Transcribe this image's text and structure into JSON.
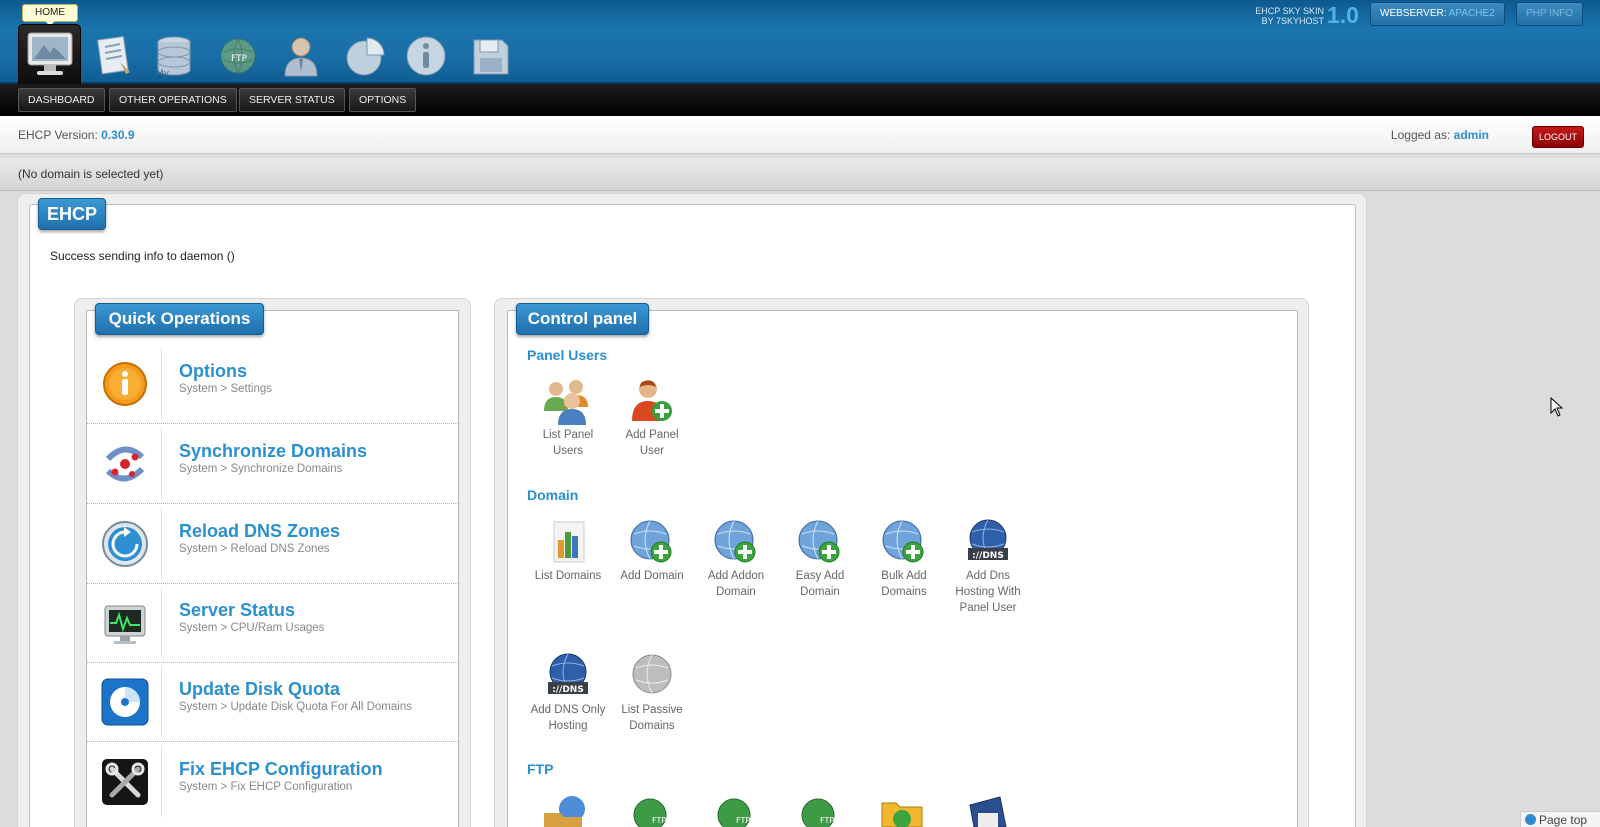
{
  "header": {
    "home_tooltip": "HOME",
    "skin_line1": "EHCP SKY SKIN",
    "skin_line2": "BY 7SKYHOST",
    "skin_version": "1.0",
    "webserver_label": "WEBSERVER:",
    "webserver_value": "APACHE2",
    "phpinfo_label": "PHP INFO",
    "nav_icons": [
      "home-monitor-icon",
      "document-icon",
      "mysql-database-icon",
      "ftp-globe-icon",
      "user-icon",
      "pie-chart-icon",
      "info-icon",
      "floppy-disk-icon"
    ]
  },
  "menu": {
    "dashboard": "DASHBOARD",
    "other_operations": "OTHER OPERATIONS",
    "server_status": "SERVER STATUS",
    "options": "OPTIONS"
  },
  "info": {
    "version_label": "EHCP Version:",
    "version_value": "0.30.9",
    "logged_label": "Logged as:",
    "logged_user": "admin",
    "logout_label": "LOGOUT",
    "domain_status": "(No domain is selected yet)"
  },
  "main": {
    "tab": "EHCP",
    "message": "Success sending info to daemon ()"
  },
  "quick_ops": {
    "title": "Quick Operations",
    "items": [
      {
        "title": "Options",
        "subtitle": "System > Settings",
        "icon": "info-icon"
      },
      {
        "title": "Synchronize Domains",
        "subtitle": "System > Synchronize Domains",
        "icon": "sync-icon"
      },
      {
        "title": "Reload DNS Zones",
        "subtitle": "System > Reload DNS Zones",
        "icon": "reload-icon"
      },
      {
        "title": "Server Status",
        "subtitle": "System > CPU/Ram Usages",
        "icon": "monitor-icon"
      },
      {
        "title": "Update Disk Quota",
        "subtitle": "System > Update Disk Quota For All Domains",
        "icon": "disk-icon"
      },
      {
        "title": "Fix EHCP Configuration",
        "subtitle": "System > Fix EHCP Configuration",
        "icon": "tools-icon"
      }
    ]
  },
  "control_panel": {
    "title": "Control panel",
    "panel_users": {
      "title": "Panel Users",
      "items": [
        {
          "label_1": "List Panel",
          "label_2": "Users",
          "label_3": ""
        },
        {
          "label_1": "Add Panel",
          "label_2": "User",
          "label_3": ""
        }
      ]
    },
    "domain": {
      "title": "Domain",
      "items": [
        {
          "label_1": "List Domains",
          "label_2": "",
          "label_3": ""
        },
        {
          "label_1": "Add Domain",
          "label_2": "",
          "label_3": ""
        },
        {
          "label_1": "Add Addon",
          "label_2": "Domain",
          "label_3": ""
        },
        {
          "label_1": "Easy Add",
          "label_2": "Domain",
          "label_3": ""
        },
        {
          "label_1": "Bulk Add",
          "label_2": "Domains",
          "label_3": ""
        },
        {
          "label_1": "Add Dns",
          "label_2": "Hosting With",
          "label_3": "Panel User"
        },
        {
          "label_1": "Add DNS Only",
          "label_2": "Hosting",
          "label_3": ""
        },
        {
          "label_1": "List Passive",
          "label_2": "Domains",
          "label_3": ""
        }
      ],
      "dns_badge": "://DNS"
    },
    "ftp": {
      "title": "FTP",
      "ftp_badge": "FTP"
    }
  },
  "footer": {
    "page_top": "Page top"
  }
}
